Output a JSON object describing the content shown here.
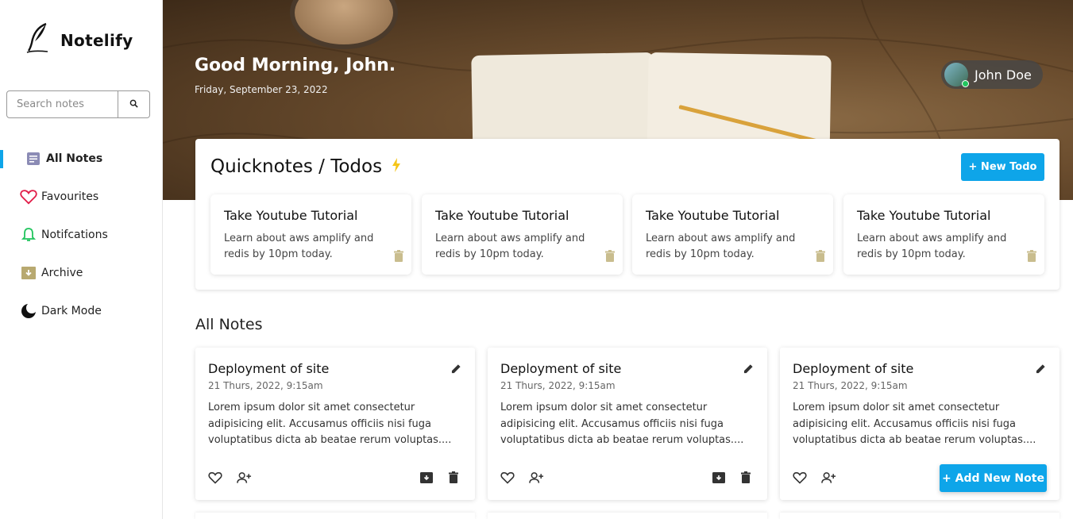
{
  "app": {
    "name": "Notelify",
    "logo_icon": "quill-icon"
  },
  "search": {
    "placeholder": "Search notes",
    "button_icon": "search-icon"
  },
  "sidebar": {
    "items": [
      {
        "label": "All Notes",
        "icon": "note-icon",
        "active": true
      },
      {
        "label": "Favourites",
        "icon": "heart-icon"
      },
      {
        "label": "Notifcations",
        "icon": "bell-icon"
      },
      {
        "label": "Archive",
        "icon": "archive-icon"
      },
      {
        "label": "Dark Mode",
        "icon": "moon-icon"
      }
    ]
  },
  "header": {
    "greeting": "Good Morning, John.",
    "date": "Friday, September 23, 2022",
    "user": {
      "name": "John Doe",
      "status_color": "#22c55e"
    }
  },
  "quicknotes": {
    "title": "Quicknotes / Todos",
    "new_button": "+ New Todo",
    "todos": [
      {
        "title": "Take Youtube Tutorial",
        "desc": "Learn about aws amplify and redis by 10pm today."
      },
      {
        "title": "Take Youtube Tutorial",
        "desc": "Learn about aws amplify and redis by 10pm today."
      },
      {
        "title": "Take Youtube Tutorial",
        "desc": "Learn about aws amplify and redis by 10pm today."
      },
      {
        "title": "Take Youtube Tutorial",
        "desc": "Learn about aws amplify and redis by 10pm today."
      }
    ]
  },
  "notes": {
    "title": "All Notes",
    "items": [
      {
        "title": "Deployment of site",
        "date": "21 Thurs, 2022, 9:15am",
        "body": "Lorem ipsum dolor sit amet consectetur adipisicing elit. Accusamus officiis nisi fuga voluptatibus dicta ab beatae rerum voluptas...."
      },
      {
        "title": "Deployment of site",
        "date": "21 Thurs, 2022, 9:15am",
        "body": "Lorem ipsum dolor sit amet consectetur adipisicing elit. Accusamus officiis nisi fuga voluptatibus dicta ab beatae rerum voluptas...."
      },
      {
        "title": "Deployment of site",
        "date": "21 Thurs, 2022, 9:15am",
        "body": "Lorem ipsum dolor sit amet consectetur adipisicing elit. Accusamus officiis nisi fuga voluptatibus dicta ab beatae rerum voluptas...."
      }
    ],
    "add_button": "+ Add New Note"
  },
  "colors": {
    "accent": "#0ea5e9",
    "heart": "#e11d48",
    "bell": "#22c55e",
    "archive": "#b8a970",
    "trash_light": "#c9bd8e"
  }
}
